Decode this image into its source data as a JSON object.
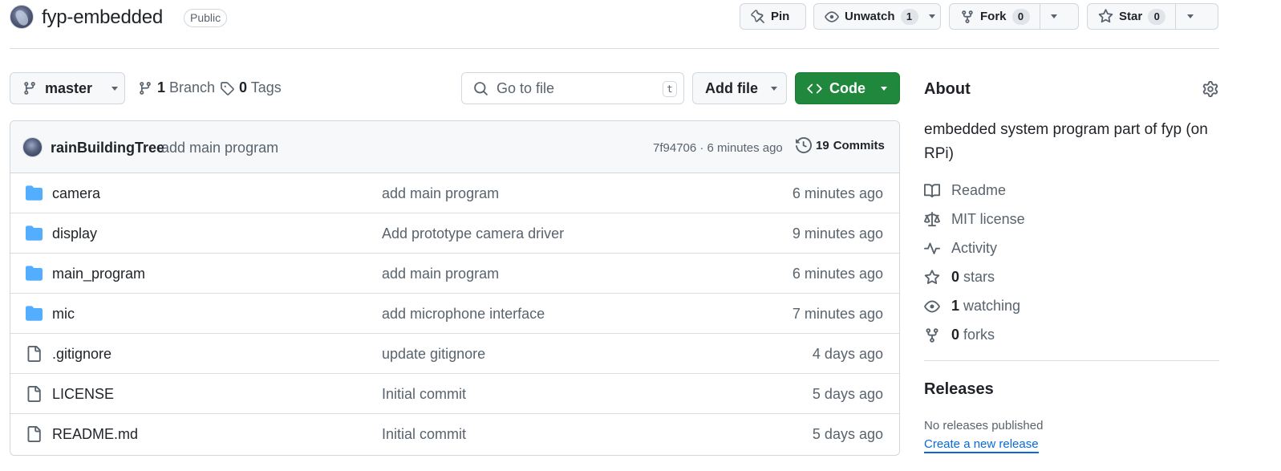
{
  "repo": {
    "name": "fyp-embedded",
    "visibility": "Public"
  },
  "header_actions": {
    "pin_label": "Pin",
    "watch_label": "Unwatch",
    "watch_count": "1",
    "fork_label": "Fork",
    "fork_count": "0",
    "star_label": "Star",
    "star_count": "0"
  },
  "toolbar": {
    "branch": "master",
    "branch_count": "1",
    "branch_word": "Branch",
    "tag_count": "0",
    "tag_word": "Tags",
    "goto_placeholder": "Go to file",
    "goto_shortcut": "t",
    "add_file_label": "Add file",
    "code_label": "Code"
  },
  "latest_commit": {
    "author": "rainBuildingTree",
    "message": "add main program",
    "sha_time": "7f94706 · 6 minutes ago",
    "commits_count": "19",
    "commits_word": "Commits"
  },
  "files": [
    {
      "name": "camera",
      "type": "folder",
      "message": "add main program",
      "date": "6 minutes ago"
    },
    {
      "name": "display",
      "type": "folder",
      "message": "Add prototype camera driver",
      "date": "9 minutes ago"
    },
    {
      "name": "main_program",
      "type": "folder",
      "message": "add main program",
      "date": "6 minutes ago"
    },
    {
      "name": "mic",
      "type": "folder",
      "message": "add microphone interface",
      "date": "7 minutes ago"
    },
    {
      "name": ".gitignore",
      "type": "file",
      "message": "update gitignore",
      "date": "4 days ago"
    },
    {
      "name": "LICENSE",
      "type": "file",
      "message": "Initial commit",
      "date": "5 days ago"
    },
    {
      "name": "README.md",
      "type": "file",
      "message": "Initial commit",
      "date": "5 days ago"
    }
  ],
  "about": {
    "title": "About",
    "description": "embedded system program part of fyp (on RPi)",
    "readme": "Readme",
    "license": "MIT license",
    "activity": "Activity",
    "stars_count": "0",
    "stars_word": "stars",
    "watching_count": "1",
    "watching_word": "watching",
    "forks_count": "0",
    "forks_word": "forks"
  },
  "releases": {
    "title": "Releases",
    "none_text": "No releases published",
    "create_link": "Create a new release"
  },
  "colors": {
    "accent_green": "#1f883d",
    "link_blue": "#0969da",
    "folder_blue": "#54aeff",
    "muted_text": "#59636e",
    "border": "#d0d7de"
  },
  "icons": {
    "folder": "folder-icon",
    "file": "file-icon"
  }
}
